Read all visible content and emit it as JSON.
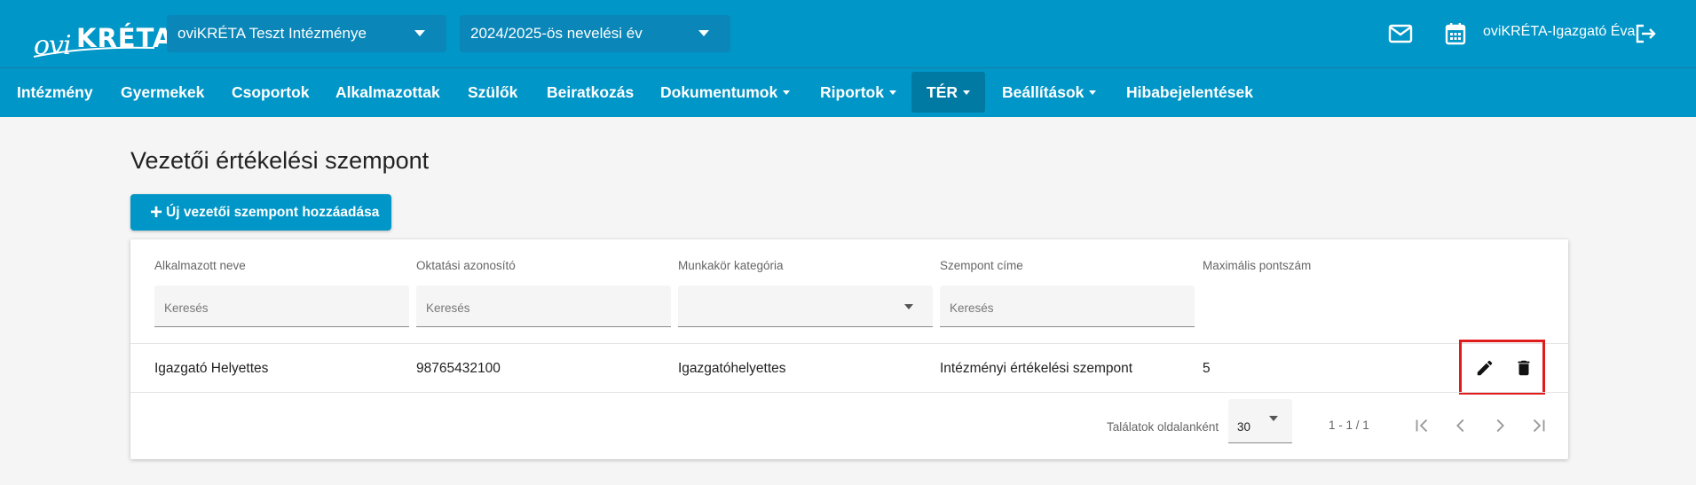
{
  "header": {
    "logo_ovi": "ovi",
    "logo_kreta": "KRÉTA",
    "institution": "oviKRÉTA Teszt Intézménye",
    "year": "2024/2025-ös nevelési év",
    "user": "oviKRÉTA-Igazgató Éva",
    "icons": [
      "mail-icon",
      "calendar-icon",
      "logout-icon"
    ]
  },
  "nav": {
    "items": [
      {
        "label": "Intézmény",
        "dropdown": false
      },
      {
        "label": "Gyermekek",
        "dropdown": false
      },
      {
        "label": "Csoportok",
        "dropdown": false
      },
      {
        "label": "Alkalmazottak",
        "dropdown": false
      },
      {
        "label": "Szülők",
        "dropdown": false
      },
      {
        "label": "Beiratkozás",
        "dropdown": false
      },
      {
        "label": "Dokumentumok",
        "dropdown": true
      },
      {
        "label": "Riportok",
        "dropdown": true
      },
      {
        "label": "TÉR",
        "dropdown": true,
        "active": true
      },
      {
        "label": "Beállítások",
        "dropdown": true
      },
      {
        "label": "Hibabejelentések",
        "dropdown": false
      }
    ]
  },
  "page": {
    "title": "Vezetői értékelési szempont",
    "add_button": "Új vezetői szempont hozzáadása"
  },
  "table": {
    "columns": [
      "Alkalmazott neve",
      "Oktatási azonosító",
      "Munkakör kategória",
      "Szempont címe",
      "Maximális pontszám"
    ],
    "filter_placeholder": "Keresés",
    "rows": [
      [
        "Igazgató Helyettes",
        "98765432100",
        "Igazgatóhelyettes",
        "Intézményi értékelési szempont",
        "5"
      ]
    ],
    "row_actions": [
      "pencil-icon",
      "trash-icon"
    ]
  },
  "pagination": {
    "per_page_label": "Találatok oldalanként",
    "per_page": "30",
    "range": "1 - 1 / 1"
  },
  "colors": {
    "primary": "#0096c7",
    "nav_active": "#007aa3",
    "highlight": "#e01b1b",
    "background": "#f5f5f5"
  }
}
